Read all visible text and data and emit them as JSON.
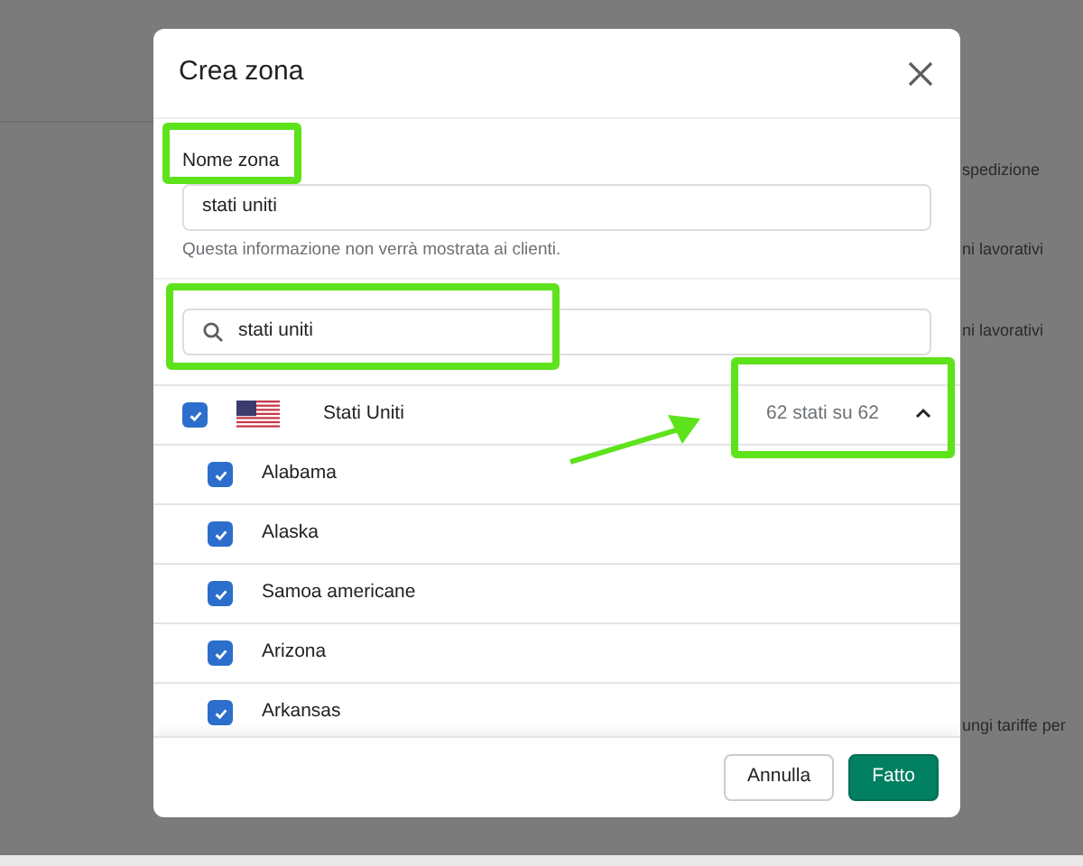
{
  "background": {
    "texts": [
      "spedizione",
      "ni lavorativi",
      "ni lavorativi",
      "ungi tariffe per"
    ]
  },
  "modal": {
    "title": "Crea zona",
    "name_field": {
      "label": "Nome zona",
      "value": "stati uniti",
      "help": "Questa informazione non verrà mostrata ai clienti."
    },
    "search": {
      "value": "stati uniti"
    },
    "country": {
      "name": "Stati Uniti",
      "checked": true,
      "count": "62 stati su 62",
      "expanded": true,
      "children": [
        {
          "name": "Alabama",
          "checked": true
        },
        {
          "name": "Alaska",
          "checked": true
        },
        {
          "name": "Samoa americane",
          "checked": true
        },
        {
          "name": "Arizona",
          "checked": true
        },
        {
          "name": "Arkansas",
          "checked": true
        }
      ]
    },
    "buttons": [
      {
        "label": "Annulla",
        "kind": "secondary"
      },
      {
        "label": "Fatto",
        "kind": "primary"
      }
    ]
  }
}
